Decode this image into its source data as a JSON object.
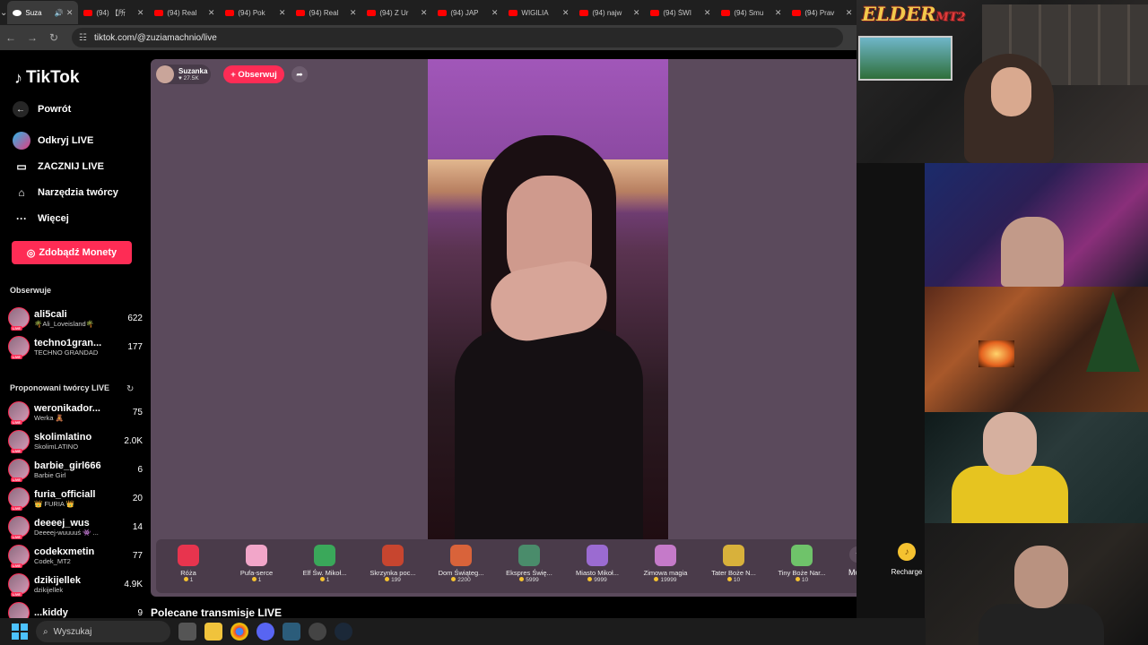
{
  "browser": {
    "tabs": [
      {
        "label": "Suza",
        "active": true,
        "sound": true
      },
      {
        "label": "(94) 【所",
        "active": false
      },
      {
        "label": "(94) Real",
        "active": false
      },
      {
        "label": "(94) Pok",
        "active": false
      },
      {
        "label": "(94) Real",
        "active": false
      },
      {
        "label": "(94) Z Ur",
        "active": false
      },
      {
        "label": "(94) JAP",
        "active": false
      },
      {
        "label": "WIGILIA",
        "active": false
      },
      {
        "label": "(94) najw",
        "active": false
      },
      {
        "label": "(94) ŚWI",
        "active": false
      },
      {
        "label": "(94) Smu",
        "active": false
      },
      {
        "label": "(94) Prav",
        "active": false
      }
    ],
    "url": "tiktok.com/@zuziamachnio/live"
  },
  "sidebar": {
    "logo": "TikTok",
    "back": "Powrót",
    "nav": [
      {
        "label": "Odkryj LIVE",
        "icon": "live-discover-icon"
      },
      {
        "label": "ZACZNIJ LIVE",
        "icon": "camera-icon"
      },
      {
        "label": "Narzędzia twórcy",
        "icon": "creator-tools-icon"
      },
      {
        "label": "Więcej",
        "icon": "more-dots-icon"
      }
    ],
    "coins_button": "Zdobądź Monety",
    "following_title": "Obserwuje",
    "following": [
      {
        "username": "ali5cali",
        "nick": "🌴Ali_Loveisland🌴",
        "count": "622"
      },
      {
        "username": "techno1gran...",
        "nick": "TECHNO GRANDAD",
        "count": "177"
      }
    ],
    "suggested_title": "Proponowani twórcy LIVE",
    "suggested": [
      {
        "username": "weronikador...",
        "nick": "Werka 🧸",
        "count": "75"
      },
      {
        "username": "skolimlatino",
        "nick": "SkolimLATINO",
        "count": "2.0K"
      },
      {
        "username": "barbie_girl666",
        "nick": "Barbie Girl",
        "count": "6"
      },
      {
        "username": "furia_officiall",
        "nick": "👑 FURIA 👑",
        "count": "20"
      },
      {
        "username": "deeeej_wus",
        "nick": "Deeeej-wuuuuś 👾 ...",
        "count": "14"
      },
      {
        "username": "codekxmetin",
        "nick": "Codek_MT2",
        "count": "77"
      },
      {
        "username": "dzikijellek",
        "nick": "dzikijellek",
        "count": "4.9K"
      },
      {
        "username": "...kiddy",
        "nick": "",
        "count": "9"
      }
    ],
    "live_badge": "LIVE"
  },
  "live": {
    "host_name": "Suzanka",
    "host_likes": "27.5K",
    "follow_button": "+ Obserwuj",
    "gifts": [
      {
        "name": "Róża",
        "price": "1",
        "color": "#e8344e"
      },
      {
        "name": "Pufa-serce",
        "price": "1",
        "color": "#f2a6c9"
      },
      {
        "name": "Elf Św. Mikoł...",
        "price": "1",
        "color": "#3aa85a"
      },
      {
        "name": "Skrzynka poc...",
        "price": "199",
        "color": "#c7452f"
      },
      {
        "name": "Dom Świąteg...",
        "price": "2200",
        "color": "#d9633a"
      },
      {
        "name": "Ekspres Świę...",
        "price": "5999",
        "color": "#4a8c6b"
      },
      {
        "name": "Miasto Mikoł...",
        "price": "9999",
        "color": "#9b6bd1"
      },
      {
        "name": "Zimowa magia",
        "price": "19999",
        "color": "#c57ac9"
      },
      {
        "name": "Tater Boże N...",
        "price": "10",
        "color": "#d8b13b"
      },
      {
        "name": "Tiny Boże Nar...",
        "price": "10",
        "color": "#6fc36a"
      }
    ],
    "more_label": "More",
    "recharge_label": "Recharge"
  },
  "section_heading": "Polecane transmisje LIVE",
  "overlay": {
    "logo_main": "ELDER",
    "logo_sub": "MT2"
  },
  "taskbar": {
    "search_placeholder": "Wyszukaj"
  }
}
